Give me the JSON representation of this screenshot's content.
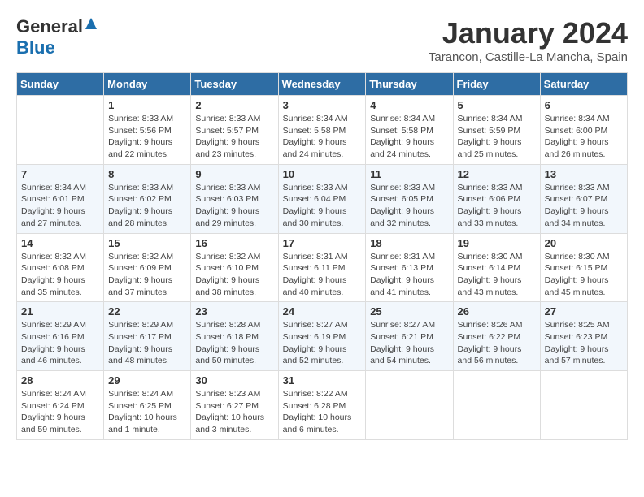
{
  "header": {
    "logo_general": "General",
    "logo_blue": "Blue",
    "title": "January 2024",
    "subtitle": "Tarancon, Castille-La Mancha, Spain"
  },
  "columns": [
    "Sunday",
    "Monday",
    "Tuesday",
    "Wednesday",
    "Thursday",
    "Friday",
    "Saturday"
  ],
  "weeks": [
    [
      {
        "day": "",
        "info": ""
      },
      {
        "day": "1",
        "info": "Sunrise: 8:33 AM\nSunset: 5:56 PM\nDaylight: 9 hours\nand 22 minutes."
      },
      {
        "day": "2",
        "info": "Sunrise: 8:33 AM\nSunset: 5:57 PM\nDaylight: 9 hours\nand 23 minutes."
      },
      {
        "day": "3",
        "info": "Sunrise: 8:34 AM\nSunset: 5:58 PM\nDaylight: 9 hours\nand 24 minutes."
      },
      {
        "day": "4",
        "info": "Sunrise: 8:34 AM\nSunset: 5:58 PM\nDaylight: 9 hours\nand 24 minutes."
      },
      {
        "day": "5",
        "info": "Sunrise: 8:34 AM\nSunset: 5:59 PM\nDaylight: 9 hours\nand 25 minutes."
      },
      {
        "day": "6",
        "info": "Sunrise: 8:34 AM\nSunset: 6:00 PM\nDaylight: 9 hours\nand 26 minutes."
      }
    ],
    [
      {
        "day": "7",
        "info": "Sunrise: 8:34 AM\nSunset: 6:01 PM\nDaylight: 9 hours\nand 27 minutes."
      },
      {
        "day": "8",
        "info": "Sunrise: 8:33 AM\nSunset: 6:02 PM\nDaylight: 9 hours\nand 28 minutes."
      },
      {
        "day": "9",
        "info": "Sunrise: 8:33 AM\nSunset: 6:03 PM\nDaylight: 9 hours\nand 29 minutes."
      },
      {
        "day": "10",
        "info": "Sunrise: 8:33 AM\nSunset: 6:04 PM\nDaylight: 9 hours\nand 30 minutes."
      },
      {
        "day": "11",
        "info": "Sunrise: 8:33 AM\nSunset: 6:05 PM\nDaylight: 9 hours\nand 32 minutes."
      },
      {
        "day": "12",
        "info": "Sunrise: 8:33 AM\nSunset: 6:06 PM\nDaylight: 9 hours\nand 33 minutes."
      },
      {
        "day": "13",
        "info": "Sunrise: 8:33 AM\nSunset: 6:07 PM\nDaylight: 9 hours\nand 34 minutes."
      }
    ],
    [
      {
        "day": "14",
        "info": "Sunrise: 8:32 AM\nSunset: 6:08 PM\nDaylight: 9 hours\nand 35 minutes."
      },
      {
        "day": "15",
        "info": "Sunrise: 8:32 AM\nSunset: 6:09 PM\nDaylight: 9 hours\nand 37 minutes."
      },
      {
        "day": "16",
        "info": "Sunrise: 8:32 AM\nSunset: 6:10 PM\nDaylight: 9 hours\nand 38 minutes."
      },
      {
        "day": "17",
        "info": "Sunrise: 8:31 AM\nSunset: 6:11 PM\nDaylight: 9 hours\nand 40 minutes."
      },
      {
        "day": "18",
        "info": "Sunrise: 8:31 AM\nSunset: 6:13 PM\nDaylight: 9 hours\nand 41 minutes."
      },
      {
        "day": "19",
        "info": "Sunrise: 8:30 AM\nSunset: 6:14 PM\nDaylight: 9 hours\nand 43 minutes."
      },
      {
        "day": "20",
        "info": "Sunrise: 8:30 AM\nSunset: 6:15 PM\nDaylight: 9 hours\nand 45 minutes."
      }
    ],
    [
      {
        "day": "21",
        "info": "Sunrise: 8:29 AM\nSunset: 6:16 PM\nDaylight: 9 hours\nand 46 minutes."
      },
      {
        "day": "22",
        "info": "Sunrise: 8:29 AM\nSunset: 6:17 PM\nDaylight: 9 hours\nand 48 minutes."
      },
      {
        "day": "23",
        "info": "Sunrise: 8:28 AM\nSunset: 6:18 PM\nDaylight: 9 hours\nand 50 minutes."
      },
      {
        "day": "24",
        "info": "Sunrise: 8:27 AM\nSunset: 6:19 PM\nDaylight: 9 hours\nand 52 minutes."
      },
      {
        "day": "25",
        "info": "Sunrise: 8:27 AM\nSunset: 6:21 PM\nDaylight: 9 hours\nand 54 minutes."
      },
      {
        "day": "26",
        "info": "Sunrise: 8:26 AM\nSunset: 6:22 PM\nDaylight: 9 hours\nand 56 minutes."
      },
      {
        "day": "27",
        "info": "Sunrise: 8:25 AM\nSunset: 6:23 PM\nDaylight: 9 hours\nand 57 minutes."
      }
    ],
    [
      {
        "day": "28",
        "info": "Sunrise: 8:24 AM\nSunset: 6:24 PM\nDaylight: 9 hours\nand 59 minutes."
      },
      {
        "day": "29",
        "info": "Sunrise: 8:24 AM\nSunset: 6:25 PM\nDaylight: 10 hours\nand 1 minute."
      },
      {
        "day": "30",
        "info": "Sunrise: 8:23 AM\nSunset: 6:27 PM\nDaylight: 10 hours\nand 3 minutes."
      },
      {
        "day": "31",
        "info": "Sunrise: 8:22 AM\nSunset: 6:28 PM\nDaylight: 10 hours\nand 6 minutes."
      },
      {
        "day": "",
        "info": ""
      },
      {
        "day": "",
        "info": ""
      },
      {
        "day": "",
        "info": ""
      }
    ]
  ]
}
